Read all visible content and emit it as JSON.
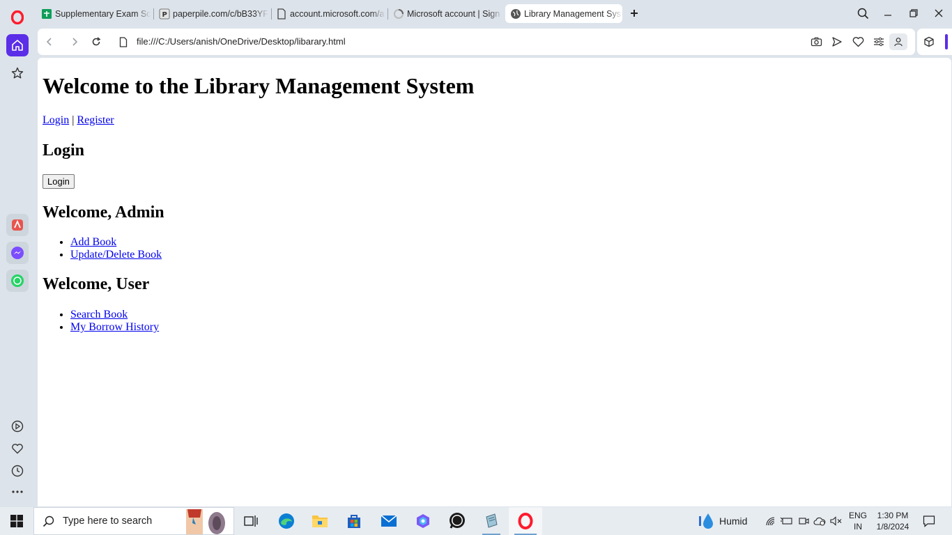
{
  "browser": {
    "tabs": [
      {
        "title": "Supplementary Exam Sche",
        "icon": "sheets-icon"
      },
      {
        "title": "paperpile.com/c/bB33YF/",
        "icon": "paperpile-icon"
      },
      {
        "title": "account.microsoft.com/ac",
        "icon": "document-icon"
      },
      {
        "title": "Microsoft account | Sign I",
        "icon": "loading-icon"
      },
      {
        "title": "Library Management Syste",
        "icon": "globe-icon",
        "active": true
      }
    ],
    "address": "file:///C:/Users/anish/OneDrive/Desktop/libarary.html",
    "accent": "#5b2ee8"
  },
  "page": {
    "title": "Welcome to the Library Management System",
    "nav_login": "Login",
    "nav_separator": "|",
    "nav_register": "Register",
    "login_heading": "Login",
    "login_button": "Login",
    "admin_heading": "Welcome, Admin",
    "admin_links": [
      "Add Book",
      "Update/Delete Book"
    ],
    "user_heading": "Welcome, User",
    "user_links": [
      "Search Book",
      "My Borrow History"
    ]
  },
  "taskbar": {
    "search_placeholder": "Type here to search",
    "weather": "Humid",
    "language": "ENG",
    "region": "IN",
    "time": "1:30 PM",
    "date": "1/8/2024"
  }
}
